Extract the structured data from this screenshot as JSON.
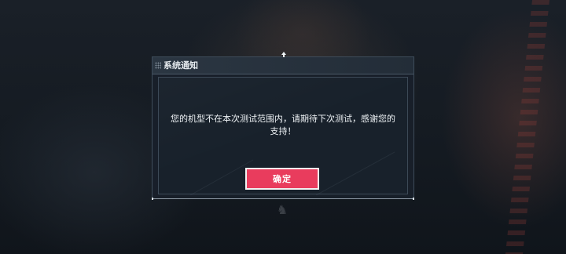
{
  "background": {
    "hint_text": "",
    "bottom_caption": "",
    "bottom_line": ""
  },
  "dialog": {
    "title": "系统通知",
    "message_lines": [
      "您的机型不在本次测试范围内，请期待下次测试，感谢您的",
      "支持！"
    ],
    "confirm_label": "确定"
  },
  "colors": {
    "accent": "#e93c5d",
    "panel": "#18212b",
    "header": "#2b3642",
    "border": "#3e4c5a"
  },
  "icons": {
    "top_pin": "pin-icon",
    "header_grip": "grip-dots-icon"
  }
}
